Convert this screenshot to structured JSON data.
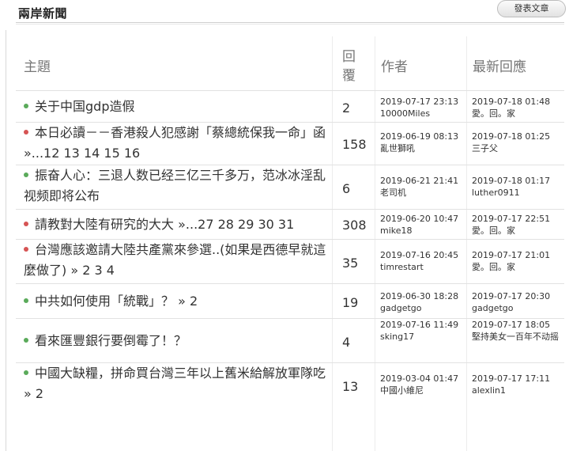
{
  "header": {
    "title": "兩岸新聞",
    "post_button": "發表文章"
  },
  "columns": {
    "topic": "主題",
    "replies": "回覆",
    "author": "作者",
    "latest": "最新回應"
  },
  "rows": [
    {
      "dot": "green",
      "topic": "关于中国gdp造假",
      "pages": "",
      "replies": "2",
      "created": "2019-07-17 23:13",
      "author": "10000Miles",
      "latest_time": "2019-07-18 01:48",
      "latest_user": "愛。回。家"
    },
    {
      "dot": "red",
      "topic": "本日必讀－－香港殺人犯感謝「蔡總統保我一命」函",
      "pages": " »...12 13 14 15 16",
      "replies": "158",
      "created": "2019-06-19 08:13",
      "author": "亂世獅吼",
      "latest_time": "2019-07-18 01:25",
      "latest_user": "三子父"
    },
    {
      "dot": "green",
      "topic": "振奋人心：三退人数已经三亿三千多万，范冰冰淫乱视频即将公布",
      "pages": "",
      "replies": "6",
      "created": "2019-06-21 21:41",
      "author": "老司机",
      "latest_time": "2019-07-18 01:17",
      "latest_user": "luther0911"
    },
    {
      "dot": "red",
      "topic": "請教對大陸有研究的大大",
      "pages": " »...27 28 29 30 31",
      "replies": "308",
      "created": "2019-06-20 10:47",
      "author": "mike18",
      "latest_time": "2019-07-17 22:51",
      "latest_user": "愛。回。家"
    },
    {
      "dot": "red",
      "topic": "台灣應該邀請大陸共產黨來參選..(如果是西德早就這麼做了)",
      "pages": " » 2 3 4",
      "replies": "35",
      "created": "2019-07-16 20:45",
      "author": "timrestart",
      "latest_time": "2019-07-17 21:01",
      "latest_user": "愛。回。家"
    },
    {
      "dot": "green",
      "topic": "中共如何使用「統戰」？",
      "pages": " » 2",
      "replies": "19",
      "created": "2019-06-30 18:28",
      "author": "gadgetgo",
      "latest_time": "2019-07-17 20:30",
      "latest_user": "gadgetgo"
    },
    {
      "dot": "green",
      "topic": "看來匯豐銀行要倒霉了！？",
      "pages": "",
      "replies": "4",
      "created": "2019-07-16 11:49",
      "author": "sking17",
      "latest_time": "2019-07-17 18:05",
      "latest_user": "堅持美女一百年不动摇"
    },
    {
      "dot": "green",
      "topic": "中國大缺糧，拼命買台灣三年以上舊米給解放軍隊吃",
      "pages": " » 2",
      "replies": "13",
      "created": "2019-03-04 01:47",
      "author": "中國小維尼",
      "latest_time": "2019-07-17 17:11",
      "latest_user": "alexlin1"
    }
  ]
}
